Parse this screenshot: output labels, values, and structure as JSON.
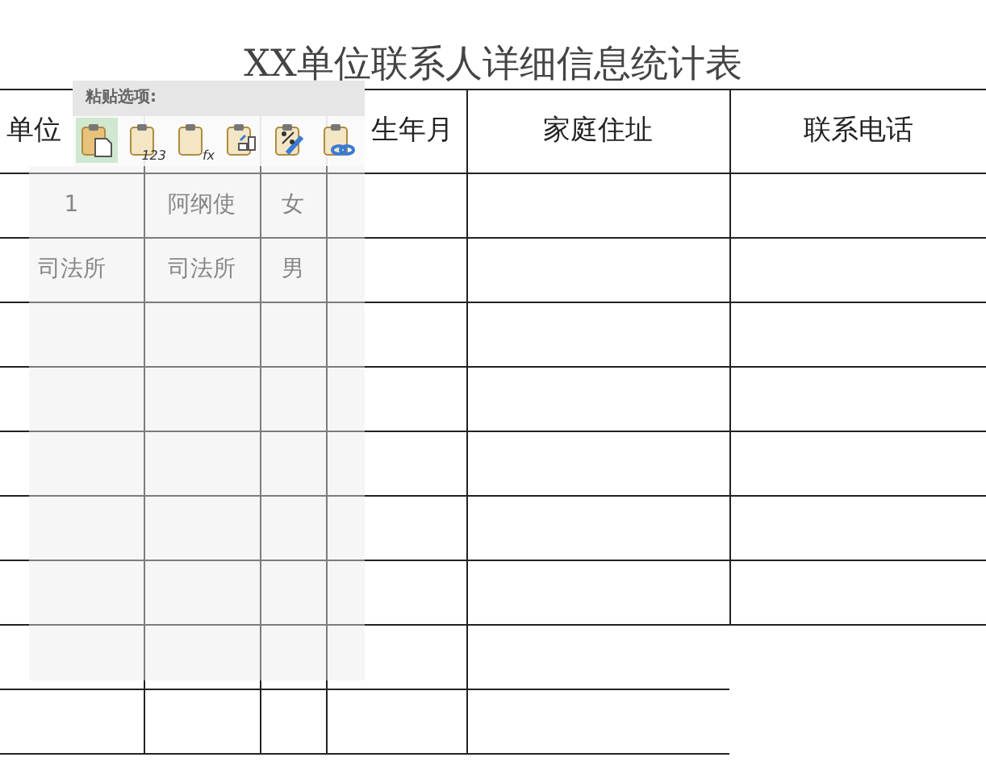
{
  "title": "XX单位联系人详细信息统计表",
  "table": {
    "columns": [
      "单位",
      "",
      "",
      "生年月",
      "家庭住址",
      "联系电话"
    ],
    "rows": [
      [
        "1",
        "阿纲使",
        "女",
        "",
        "",
        ""
      ],
      [
        "司法所",
        "司法所",
        "男",
        "",
        "",
        ""
      ],
      [
        "",
        "",
        "",
        "",
        "",
        ""
      ],
      [
        "",
        "",
        "",
        "",
        "",
        ""
      ],
      [
        "",
        "",
        "",
        "",
        "",
        ""
      ],
      [
        "",
        "",
        "",
        "",
        "",
        ""
      ],
      [
        "",
        "",
        "",
        "",
        "",
        ""
      ],
      [
        "",
        "",
        "",
        "",
        "",
        ""
      ],
      [
        "",
        "",
        "",
        "",
        "",
        ""
      ]
    ]
  },
  "paste_options": {
    "title": "粘贴选项:",
    "options": [
      {
        "kind": "paste",
        "selected": true
      },
      {
        "kind": "values",
        "badge": "123",
        "selected": false
      },
      {
        "kind": "formulas",
        "badge": "fx",
        "selected": false
      },
      {
        "kind": "transpose",
        "selected": false
      },
      {
        "kind": "formatting",
        "selected": false
      },
      {
        "kind": "link",
        "selected": false
      }
    ]
  }
}
